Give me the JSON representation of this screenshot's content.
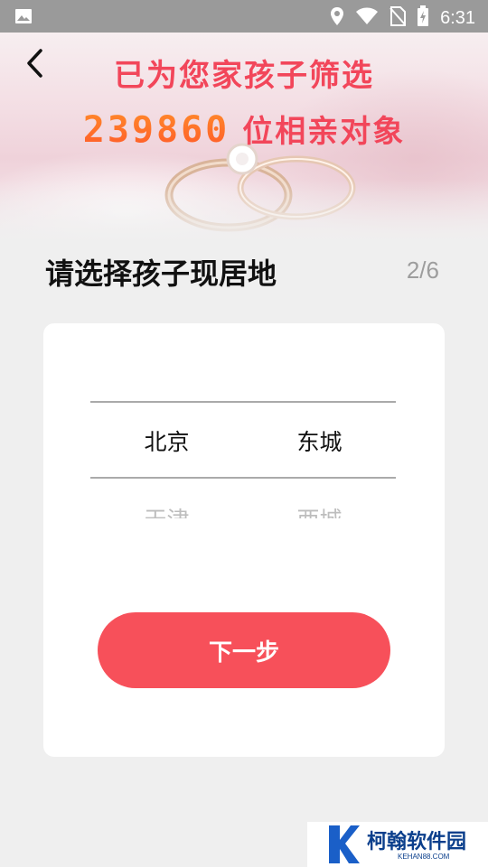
{
  "status_bar": {
    "time": "6:31",
    "icons": [
      "gallery-icon",
      "location-icon",
      "wifi-icon",
      "no-sim-icon",
      "battery-icon"
    ]
  },
  "banner": {
    "line1": "已为您家孩子筛选",
    "count": "239860",
    "line2_suffix": "位相亲对象"
  },
  "page": {
    "title": "请选择孩子现居地",
    "step": "2/6"
  },
  "picker": {
    "province_selected": "北京",
    "city_selected": "东城",
    "province_next": "天津",
    "city_next": "西城"
  },
  "actions": {
    "next_label": "下一步"
  },
  "watermark": {
    "title": "柯翰软件园",
    "subtitle": "KEHAN88.COM"
  },
  "colors": {
    "accent": "#f7505a",
    "banner_text": "#f2465a",
    "count_orange": "#ff7a2a"
  }
}
